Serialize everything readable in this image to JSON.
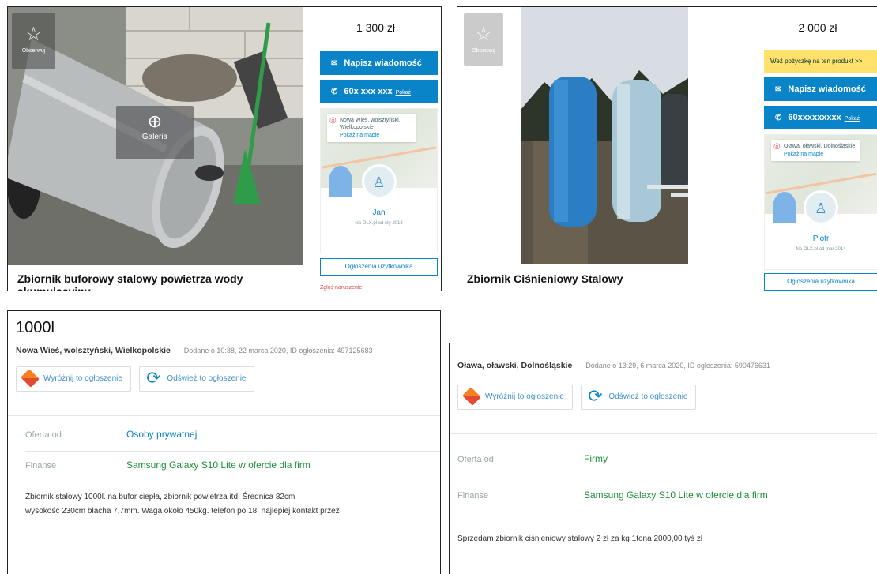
{
  "listing1": {
    "price": "1 300 zł",
    "observe_label": "Obserwuj",
    "gallery_label": "Galeria",
    "caption": "Zbiornik buforowy stalowy powietrza wody akumulacyjny",
    "message_btn": "Napisz wiadomość",
    "phone": "60x xxx xxx",
    "phone_show": "Pokaż",
    "location": "Nowa Wieś, wolsztyński, Wielkopolskie",
    "map_link": "Pokaż na mapie",
    "user_name": "Jan",
    "user_since": "Na OLX.pl od sty 2013",
    "user_ads_btn": "Ogłoszenia użytkownika",
    "report": "Zgłoś naruszenie"
  },
  "listing2": {
    "price": "2 000 zł",
    "observe_label": "Obserwuj",
    "loan_banner": "Weź pożyczkę na ten produkt >>",
    "caption": "Zbiornik Ciśnieniowy Stalowy",
    "message_btn": "Napisz wiadomość",
    "phone": "60xxxxxxxxx",
    "phone_show": "Pokaż",
    "location": "Oława, oławski, Dolnośląskie",
    "map_link": "Pokaż na mapie",
    "user_name": "Piotr",
    "user_since": "Na OLX.pl od mar 2014",
    "user_ads_btn": "Ogłoszenia użytkownika"
  },
  "detail1": {
    "title": "1000l",
    "location": "Nowa Wieś, wolsztyński, Wielkopolskie",
    "added": "Dodane o 10:38, 22 marca 2020, ID ogłoszenia: 497125683",
    "promo_highlight": "Wyróżnij to ogłoszenie",
    "promo_refresh": "Odśwież to ogłoszenie",
    "offer_from_label": "Oferta od",
    "offer_from_value": "Osoby prywatnej",
    "finance_label": "Finanse",
    "finance_value": "Samsung Galaxy S10 Lite w ofercie dla firm",
    "description_line1": "Zbiornik stalowy 1000l. na bufor ciepła, zbiornik powietrza itd. Średnica 82cm",
    "description_line2": "wysokość 230cm blacha 7,7mm. Waga około 450kg. telefon po 18. najlepiej kontakt przez"
  },
  "detail2": {
    "location": "Oława, oławski, Dolnośląskie",
    "added": "Dodane o 13:29, 6 marca 2020, ID ogłoszenia: 590476631",
    "promo_highlight": "Wyróżnij to ogłoszenie",
    "promo_refresh": "Odśwież to ogłoszenie",
    "offer_from_label": "Oferta od",
    "offer_from_value": "Firmy",
    "finance_label": "Finanse",
    "finance_value": "Samsung Galaxy S10 Lite w ofercie dla firm",
    "description": "Sprzedam zbiornik ciśnieniowy stalowy 2 zł za kg 1tona 2000,00 tyś zł"
  },
  "colors": {
    "accent": "#0a84c8",
    "finance_green": "#1f8f3a",
    "loan_yellow": "#ffe16b"
  }
}
